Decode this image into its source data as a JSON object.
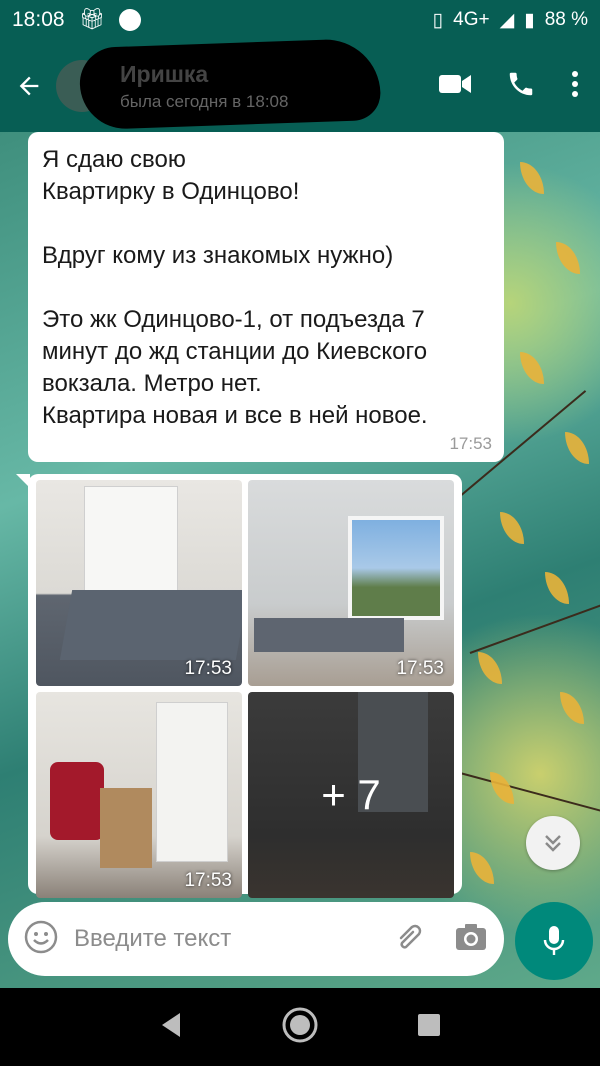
{
  "status_bar": {
    "time": "18:08",
    "network": "4G+",
    "battery": "88 %"
  },
  "header": {
    "contact_name": "Иришка",
    "contact_status": "была сегодня в 18:08"
  },
  "message": {
    "lines": [
      "Я сдаю свою",
      "Квартирку в Одинцово!",
      "",
      "Вдруг кому из знакомых нужно)",
      "",
      "Это жк Одинцово-1, от подъезда 7",
      "минут до жд станции до Киевского",
      "вокзала. Метро нет.",
      "Квартира новая и все в ней новое."
    ],
    "time": "17:53"
  },
  "gallery": {
    "photos": [
      {
        "time": "17:53"
      },
      {
        "time": "17:53"
      },
      {
        "time": "17:53"
      }
    ],
    "more_label": "+ 7"
  },
  "composer": {
    "placeholder": "Введите текст"
  },
  "icons": {
    "back": "arrow-back-icon",
    "video": "video-call-icon",
    "call": "phone-icon",
    "menu": "more-vert-icon",
    "emoji": "emoji-icon",
    "attach": "paperclip-icon",
    "camera": "camera-icon",
    "mic": "mic-icon",
    "scroll": "double-chevron-down-icon"
  },
  "colors": {
    "header": "#075E54",
    "accent": "#00897B",
    "bubble": "#FFFFFF"
  }
}
